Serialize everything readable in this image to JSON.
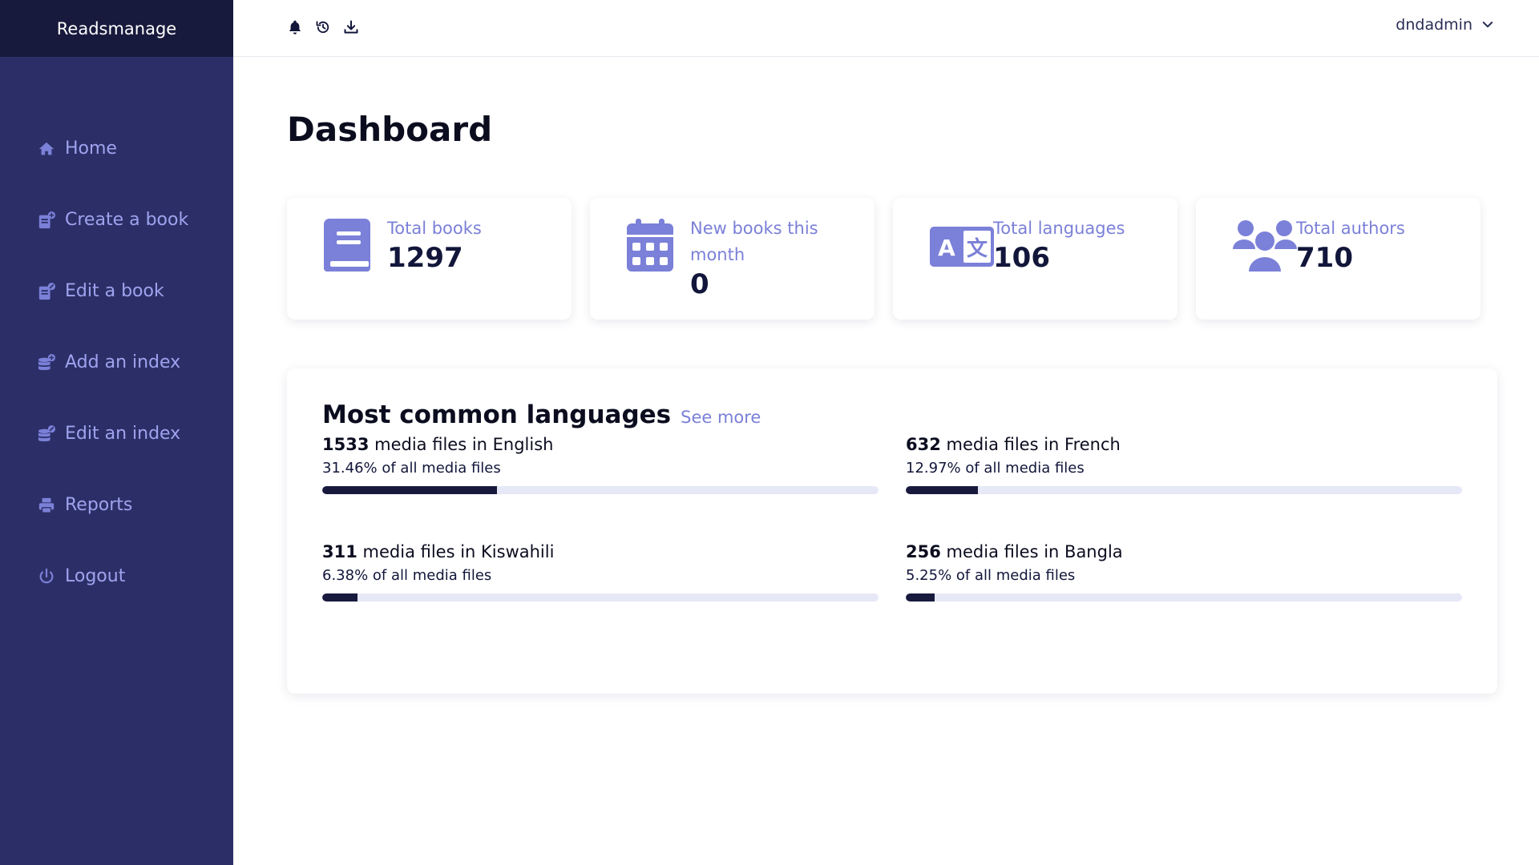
{
  "app": {
    "brand": "Readsmanage"
  },
  "sidebar": {
    "items": [
      {
        "label": "Home",
        "icon": "home-icon"
      },
      {
        "label": "Create a book",
        "icon": "book-plus-icon"
      },
      {
        "label": "Edit a book",
        "icon": "book-edit-icon"
      },
      {
        "label": "Add an index",
        "icon": "database-plus-icon"
      },
      {
        "label": "Edit an index",
        "icon": "database-edit-icon"
      },
      {
        "label": "Reports",
        "icon": "printer-icon"
      },
      {
        "label": "Logout",
        "icon": "power-icon"
      }
    ]
  },
  "topbar": {
    "icons": [
      "bell-icon",
      "history-icon",
      "download-icon"
    ],
    "username": "dndadmin"
  },
  "page": {
    "title": "Dashboard"
  },
  "stats": [
    {
      "label": "Total books",
      "value": "1297",
      "icon": "book-icon"
    },
    {
      "label": "New books this month",
      "value": "0",
      "icon": "calendar-icon"
    },
    {
      "label": "Total languages",
      "value": "106",
      "icon": "language-icon"
    },
    {
      "label": "Total authors",
      "value": "710",
      "icon": "users-icon"
    }
  ],
  "languages": {
    "title": "Most common languages",
    "see_more": "See more",
    "items": [
      {
        "count": "1533",
        "text": "media files in English",
        "percent_text": "31.46% of all media files",
        "percent": 31.46
      },
      {
        "count": "632",
        "text": "media files in French",
        "percent_text": "12.97% of all media files",
        "percent": 12.97
      },
      {
        "count": "311",
        "text": "media files in Kiswahili",
        "percent_text": "6.38% of all media files",
        "percent": 6.38
      },
      {
        "count": "256",
        "text": "media files in Bangla",
        "percent_text": "5.25% of all media files",
        "percent": 5.25
      }
    ]
  },
  "colors": {
    "sidebar_bg": "#2c2f67",
    "brand_bg": "#171a3c",
    "accent": "#7b80d8",
    "bar_fill": "#171a3c",
    "bar_track": "#e6e8f7"
  }
}
